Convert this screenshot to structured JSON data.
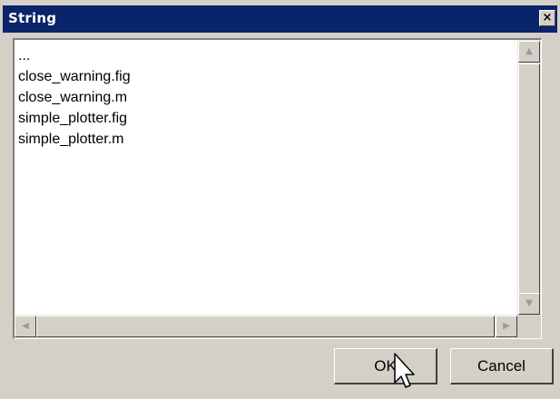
{
  "window": {
    "title": "String",
    "close_glyph": "×"
  },
  "list": {
    "items": [
      "...",
      "close_warning.fig",
      "close_warning.m",
      "simple_plotter.fig",
      "simple_plotter.m"
    ]
  },
  "scrollbar": {
    "up_glyph": "▲",
    "down_glyph": "▼",
    "left_glyph": "◀",
    "right_glyph": "▶"
  },
  "buttons": {
    "ok_label": "OK",
    "cancel_label": "Cancel"
  },
  "icons": {
    "close": "close-icon",
    "cursor": "mouse-pointer-icon"
  },
  "colors": {
    "titlebar": "#0a246a",
    "dialog_background": "#d4d0c8"
  }
}
